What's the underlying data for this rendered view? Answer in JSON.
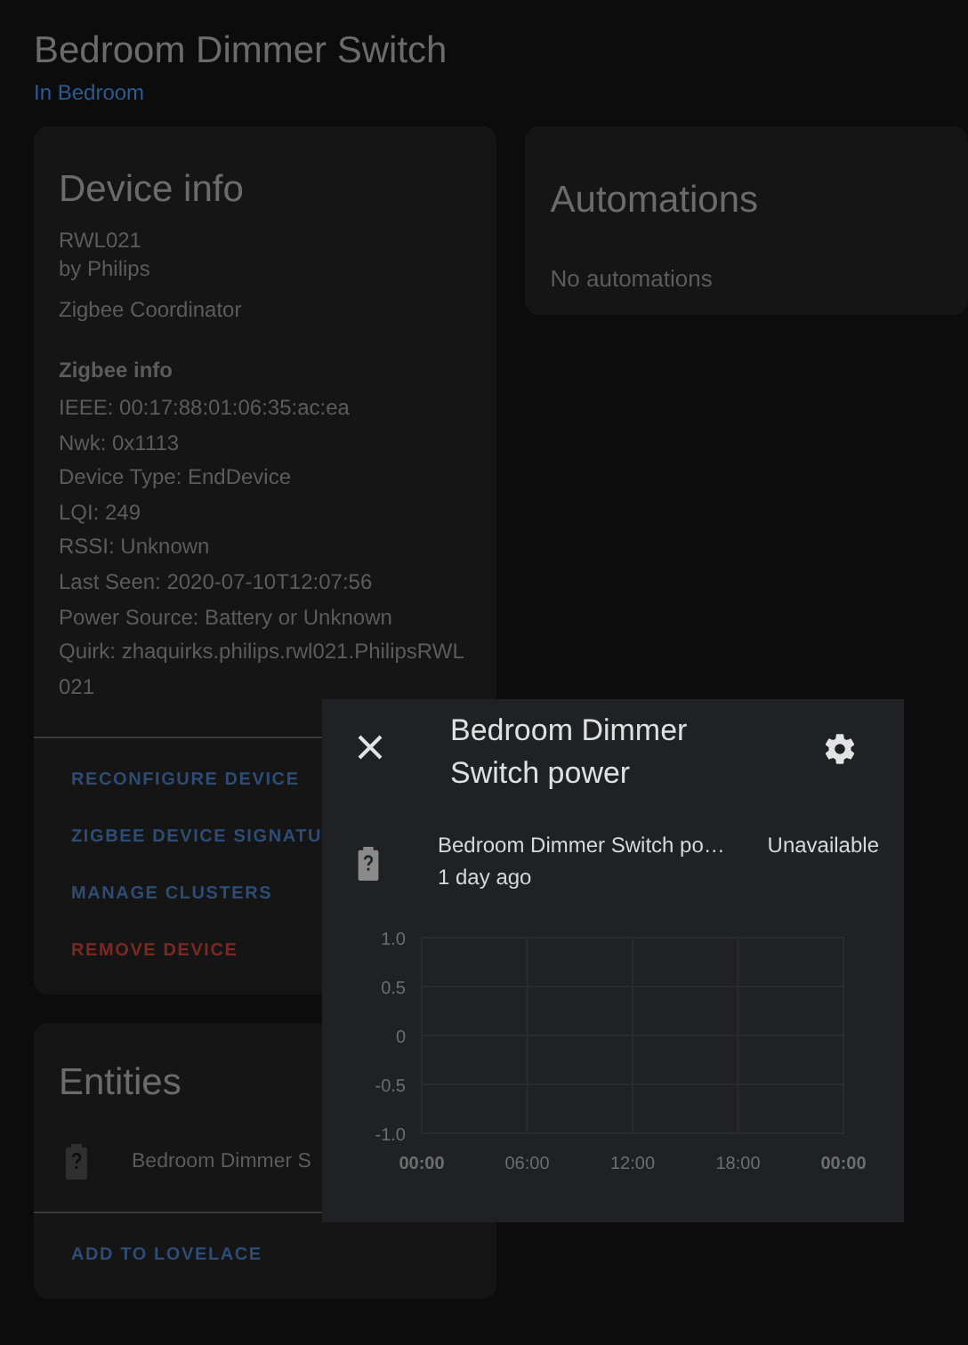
{
  "page": {
    "title": "Bedroom Dimmer Switch",
    "area_link": "In Bedroom"
  },
  "device_info": {
    "title": "Device info",
    "model": "RWL021",
    "manufacturer": "by Philips",
    "via": "Zigbee Coordinator",
    "zigbee_heading": "Zigbee info",
    "details": [
      "IEEE: 00:17:88:01:06:35:ac:ea",
      "Nwk: 0x1113",
      "Device Type: EndDevice",
      "LQI: 249",
      "RSSI: Unknown",
      "Last Seen: 2020-07-10T12:07:56",
      "Power Source: Battery or Unknown",
      "Quirk: zhaquirks.philips.rwl021.PhilipsRWL021"
    ],
    "actions": [
      {
        "label": "RECONFIGURE DEVICE",
        "kind": "normal"
      },
      {
        "label": "ZIGBEE DEVICE SIGNATU",
        "kind": "normal"
      },
      {
        "label": "MANAGE CLUSTERS",
        "kind": "normal"
      },
      {
        "label": "REMOVE DEVICE",
        "kind": "danger"
      }
    ]
  },
  "automations": {
    "title": "Automations",
    "empty": "No automations"
  },
  "entities": {
    "title": "Entities",
    "rows": [
      {
        "name": "Bedroom Dimmer S"
      }
    ],
    "action": "ADD TO LOVELACE"
  },
  "dialog": {
    "title": "Bedroom Dimmer Switch power",
    "entity_name": "Bedroom Dimmer Switch po…",
    "last_changed": "1 day ago",
    "state": "Unavailable",
    "history_graph": {
      "y_labels": [
        "1.0",
        "0.5",
        "0",
        "-0.5",
        "-1.0"
      ],
      "x_labels": [
        "00:00",
        "06:00",
        "12:00",
        "18:00",
        "00:00"
      ]
    }
  }
}
